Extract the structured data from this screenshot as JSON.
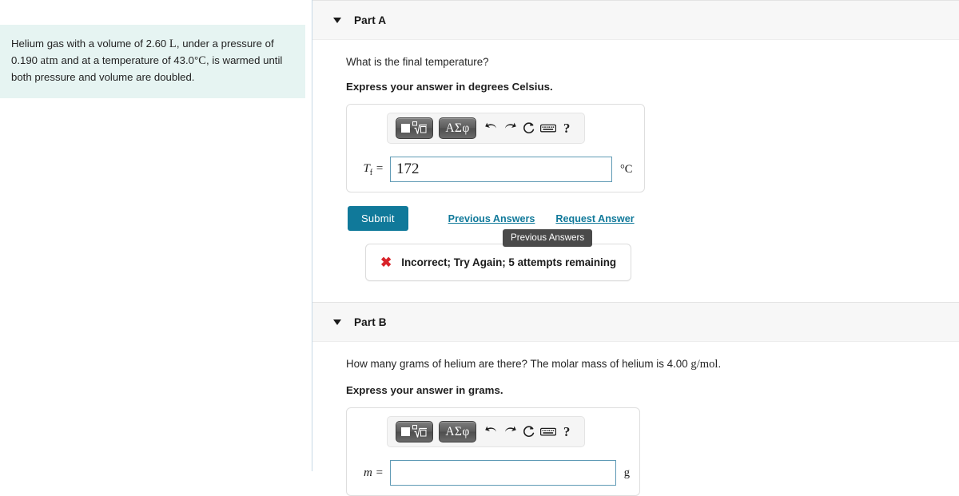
{
  "problem": {
    "text_parts": [
      {
        "t": "Helium gas with a volume of 2.60 ",
        "math": false
      },
      {
        "t": "L",
        "math": true
      },
      {
        "t": ", under a pressure of 0.190 ",
        "math": false
      },
      {
        "t": "atm",
        "math": true
      },
      {
        "t": " and at a temperature of 43.0°",
        "math": false
      },
      {
        "t": "C",
        "math": true
      },
      {
        "t": ", is warmed until both pressure and volume are doubled.",
        "math": false
      }
    ],
    "full_text": "Helium gas with a volume of 2.60 L, under a pressure of 0.190 atm and at a temperature of 43.0°C, is warmed until both pressure and volume are doubled."
  },
  "parts": [
    {
      "id": "A",
      "header_label": "Part A",
      "caret_icon": "caret-down-icon",
      "question": "What is the final temperature?",
      "instruction": "Express your answer in degrees Celsius.",
      "toolbar": {
        "template_button_label": "■√□",
        "template_button_name": "math-template-button",
        "greek_button_label": "ΑΣφ",
        "greek_button_name": "greek-symbols-button",
        "icons": [
          {
            "name": "undo-icon",
            "glyph": "↩"
          },
          {
            "name": "redo-icon",
            "glyph": "↪"
          },
          {
            "name": "reset-icon",
            "glyph": "↻"
          },
          {
            "name": "keyboard-icon",
            "glyph": "⌨"
          },
          {
            "name": "help-icon",
            "glyph": "?"
          }
        ]
      },
      "variable": "T",
      "variable_subscript": "f",
      "equals": "=",
      "value": "172",
      "placeholder": "",
      "unit": "°C",
      "submit_label": "Submit",
      "links": [
        "Previous Answers",
        "Request Answer"
      ],
      "tooltip": "Previous Answers",
      "feedback": {
        "icon": "x-mark-icon",
        "symbol": "✖",
        "message": "Incorrect; Try Again; 5 attempts remaining",
        "color": "#d8232a"
      }
    },
    {
      "id": "B",
      "header_label": "Part B",
      "caret_icon": "caret-down-icon",
      "question_parts": [
        {
          "t": "How many grams of helium are there? The molar mass of helium is 4.00 ",
          "math": false
        },
        {
          "t": "g/mol",
          "math": true
        },
        {
          "t": ".",
          "math": false
        }
      ],
      "question": "How many grams of helium are there? The molar mass of helium is 4.00 g/mol.",
      "instruction": "Express your answer in grams.",
      "toolbar": {
        "template_button_label": "■√□",
        "greek_button_label": "ΑΣφ",
        "icons": [
          {
            "name": "undo-icon",
            "glyph": "↩"
          },
          {
            "name": "redo-icon",
            "glyph": "↪"
          },
          {
            "name": "reset-icon",
            "glyph": "↻"
          },
          {
            "name": "keyboard-icon",
            "glyph": "⌨"
          },
          {
            "name": "help-icon",
            "glyph": "?"
          }
        ]
      },
      "variable": "m",
      "variable_subscript": "",
      "equals": "=",
      "value": "",
      "placeholder": "",
      "unit": "g"
    }
  ],
  "colors": {
    "statement_background": "#e6f4f2",
    "submit_background": "#10799a",
    "link": "#10799a",
    "input_border": "#5f9ab5",
    "error": "#d8232a",
    "tooltip_background": "#4a4a4a",
    "header_background": "#f7f7f7"
  }
}
